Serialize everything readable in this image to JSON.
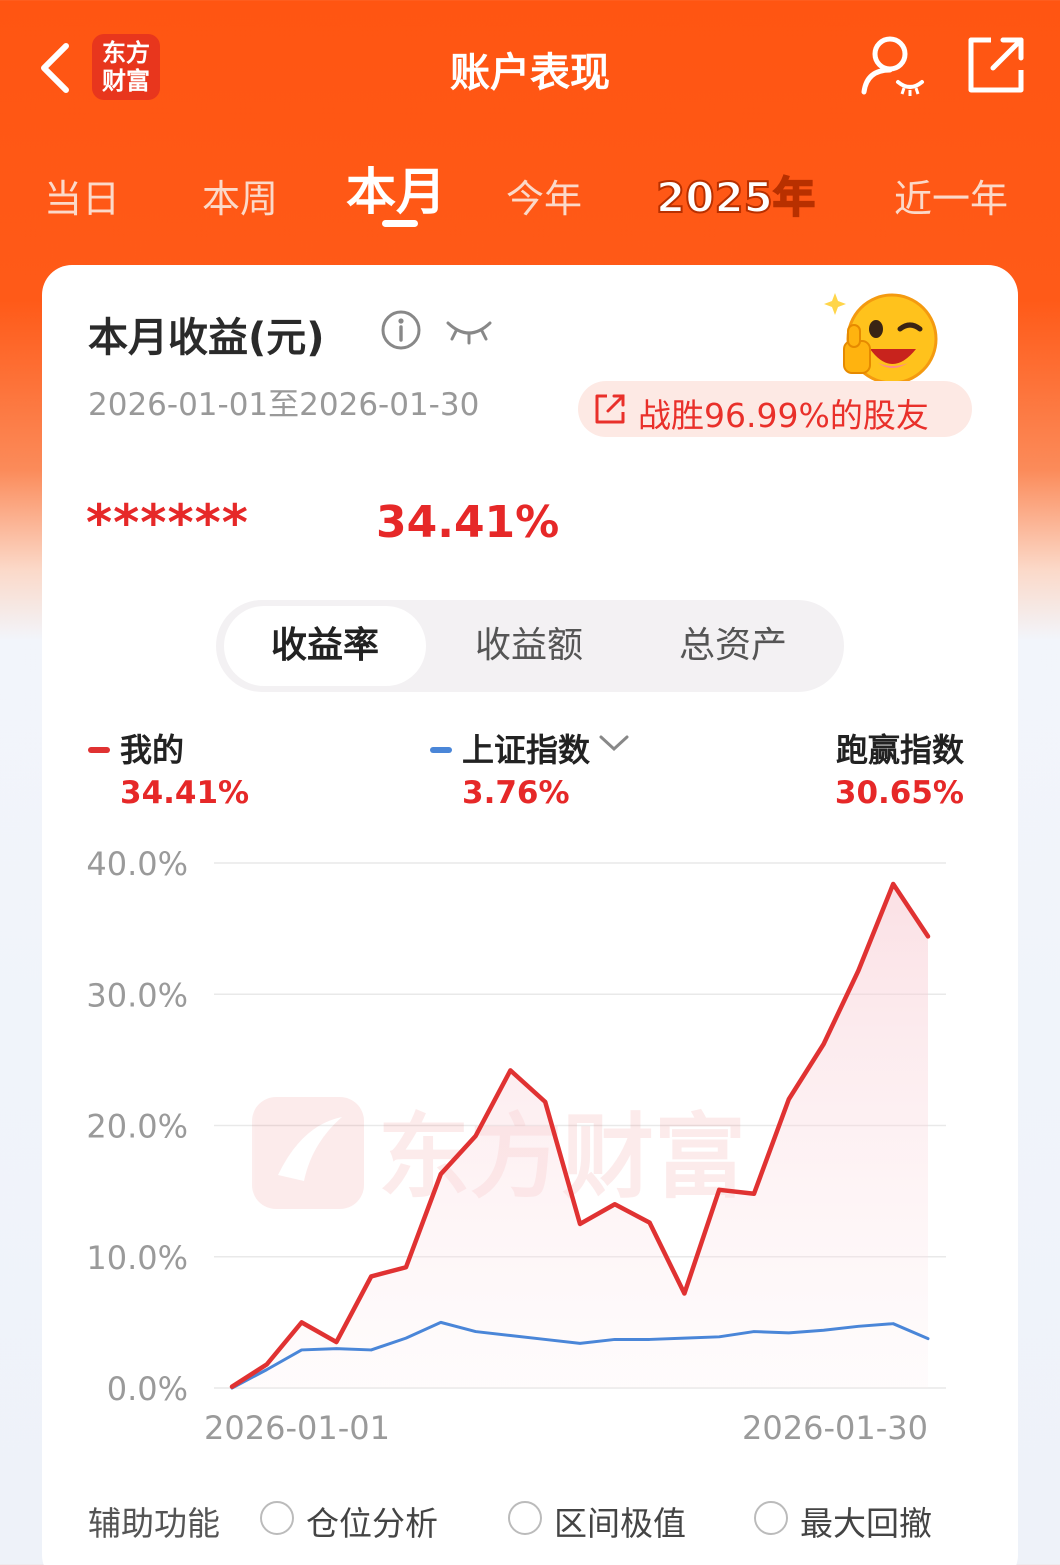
{
  "header": {
    "title": "账户表现",
    "logo_text_line1": "东方",
    "logo_text_line2": "财富"
  },
  "tabs": [
    {
      "label": "当日"
    },
    {
      "label": "本周"
    },
    {
      "label": "本月",
      "active": true
    },
    {
      "label": "今年"
    },
    {
      "label": "2025年"
    },
    {
      "label": "近一年"
    }
  ],
  "card": {
    "title": "本月收益(元)",
    "date_range": "2026-01-01至2026-01-30",
    "beat_text": "战胜96.99%的股友",
    "masked_amount": "******",
    "return_pct": "34.41%"
  },
  "segments": [
    {
      "label": "收益率",
      "active": true
    },
    {
      "label": "收益额"
    },
    {
      "label": "总资产"
    }
  ],
  "legend": {
    "mine": {
      "label": "我的",
      "value": "34.41%",
      "color": "#e03232"
    },
    "index": {
      "label": "上证指数",
      "value": "3.76%",
      "color": "#4a86d8"
    },
    "beat": {
      "label": "跑赢指数",
      "value": "30.65%"
    }
  },
  "chart_data": {
    "type": "line",
    "watermark": "东方财富",
    "y_ticks": [
      "40.0%",
      "30.0%",
      "20.0%",
      "10.0%",
      "0.0%"
    ],
    "ylim": [
      0,
      40
    ],
    "x_labels": [
      "2026-01-01",
      "2026-01-30"
    ],
    "grid": true,
    "series": [
      {
        "name": "我的",
        "color": "#e03232",
        "values": [
          0.1,
          1.8,
          5.0,
          3.5,
          8.5,
          9.2,
          16.3,
          19.2,
          24.2,
          21.8,
          12.5,
          14.0,
          12.6,
          7.2,
          15.1,
          14.8,
          22.0,
          26.2,
          31.8,
          38.4,
          34.41
        ]
      },
      {
        "name": "上证指数",
        "color": "#4a86d8",
        "values": [
          0.0,
          1.4,
          2.9,
          3.0,
          2.9,
          3.8,
          5.0,
          4.3,
          4.0,
          3.7,
          3.4,
          3.7,
          3.7,
          3.8,
          3.9,
          4.3,
          4.2,
          4.4,
          4.7,
          4.9,
          3.76
        ]
      }
    ]
  },
  "aux": {
    "label": "辅助功能",
    "options": [
      {
        "label": "仓位分析"
      },
      {
        "label": "区间极值"
      },
      {
        "label": "最大回撤"
      }
    ]
  }
}
